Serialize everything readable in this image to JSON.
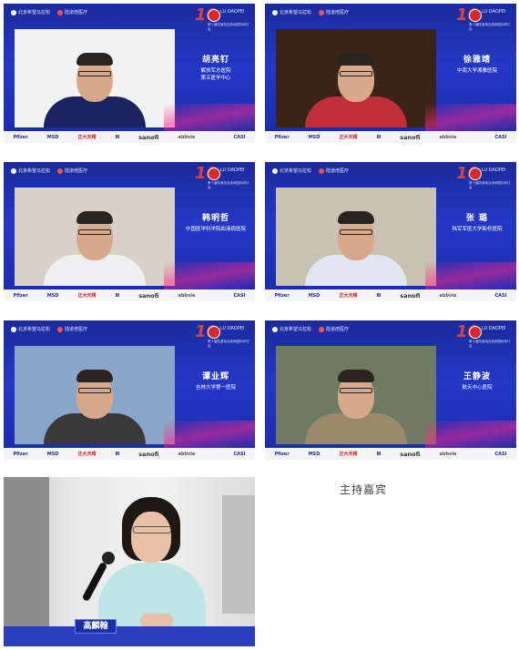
{
  "tiles": [
    {
      "name": "胡亮钉",
      "affiliation_line1": "解放军总医院",
      "affiliation_line2": "第五医学中心",
      "bg": "#f2f2f2",
      "shirt": "#1b2460"
    },
    {
      "name": "徐雅靖",
      "affiliation_line1": "中南大学湘雅医院",
      "affiliation_line2": "",
      "bg": "#3a2418",
      "shirt": "#c0303a"
    },
    {
      "name": "韩明哲",
      "affiliation_line1": "中国医学科学院血液病医院",
      "affiliation_line2": "",
      "bg": "#d7d2c8",
      "shirt": "#efeff2"
    },
    {
      "name": "张 璐",
      "affiliation_line1": "陆军军医大学新桥医院",
      "affiliation_line2": "",
      "bg": "#c9c1b3",
      "shirt": "#dfe6f2"
    },
    {
      "name": "谭业辉",
      "affiliation_line1": "吉林大学第一医院",
      "affiliation_line2": "",
      "bg": "#8aa6c8",
      "shirt": "#3a3a3a"
    },
    {
      "name": "王静波",
      "affiliation_line1": "航天中心医院",
      "affiliation_line2": "",
      "bg": "#6e7a62",
      "shirt": "#9b8a6a"
    }
  ],
  "tile_header": {
    "org1": "北京希望马拉松",
    "org2": "陆道培医疗",
    "event_num": "10",
    "event_title": "LU DAOPEI",
    "event_sub": "第十届陆道培血液病国际研讨会"
  },
  "sponsors": [
    "Pfizer",
    "MSD",
    "正大天晴",
    "Ⅲ",
    "sanofi",
    "abbvie",
    "",
    "CASI"
  ],
  "photo": {
    "nameplate": "高麟翰"
  },
  "caption": "主持嘉宾"
}
